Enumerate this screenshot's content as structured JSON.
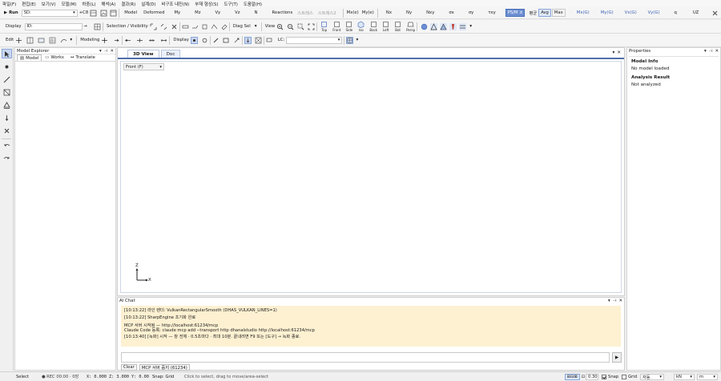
{
  "menu": [
    "파일(F)",
    "편집(E)",
    "보기(V)",
    "모델(M)",
    "하중(L)",
    "해석(A)",
    "결과(R)",
    "설계(D)",
    "비구조 내진(N)",
    "부재 형상(S)",
    "도구(T)",
    "도움말(H)"
  ],
  "toolbar1": {
    "run_label": "Run",
    "run_field": "SD:",
    "buttons": [
      "Model",
      "Deformed",
      "My",
      "Mz",
      "Vy",
      "Vz",
      "N",
      "Reactions"
    ],
    "grey_buttons": [
      "스트레스",
      "스트레스2"
    ],
    "misc": [
      "Mx(e)",
      "My(e)"
    ],
    "force_labels": [
      "Nx",
      "Ny",
      "Nxy",
      "σx",
      "σy",
      "τxy"
    ],
    "mode_button": "PS/M ±",
    "average_label": "평균",
    "avg_button": "Avg",
    "max_button": "Max",
    "result_labels": [
      "Mx(G)",
      "My(G)",
      "Vx(G)",
      "Vy(G)"
    ],
    "q_label": "q",
    "uz_label": "UZ"
  },
  "toolbar2": {
    "display_label": "Display",
    "id_field": "ID:",
    "selection_label": "Selection / Visibility",
    "diag_label": "Diag Sel",
    "view_label": "View",
    "view_buttons": [
      "Top",
      "Front",
      "Side",
      "Iso",
      "Back",
      "Left",
      "Bot",
      "Persp"
    ]
  },
  "toolbar3": {
    "edit_label": "Edit",
    "modeling_label": "Modeling",
    "display_label": "Display",
    "lc_label": "LC:"
  },
  "explorer": {
    "title": "Model Explorer",
    "tabs": [
      "Model",
      "Works",
      "Translate"
    ]
  },
  "view": {
    "tabs": [
      "3D View",
      "Doc"
    ],
    "dropdown": "Front (F)",
    "axis_z": "Z",
    "axis_x": "X"
  },
  "chat": {
    "title": "AI Chat",
    "lines": [
      "[10:13:22] 라인 렌더: VulkanRectangularSmooth (DHAS_VULKAN_LINES=1)",
      "[10:13:22] SharpEngine 초기화 완료",
      "MCP 서버 시작됨 — http://localhost:61234/mcp",
      "Claude Code 등록: claude mcp add --transport http dhanalstudio http://localhost:61234/mcp",
      "[10:13:40] [녹화] 시작 — 창 전체 · 0.5초마다 · 최대 10분. 끝내려면 F9 또는 [도구] → 녹화 종료."
    ],
    "send_icon": "▶",
    "clear_button": "Clear",
    "mcp_button": "MCP 서버 중지 (61234)"
  },
  "properties": {
    "title": "Properties",
    "model_info_heading": "Model Info",
    "model_info_value": "No model loaded",
    "analysis_heading": "Analysis Result",
    "analysis_value": "Not analyzed"
  },
  "status": {
    "mode": "Select",
    "rec": "● REC 00:00 · 0장",
    "x": "X: 0.000",
    "z": "Z: 3.000",
    "y": "Y: 0.00",
    "snap_info": "Snap: Grid",
    "hint": "Click to select, drag to move/area-select",
    "size_field": "0.30",
    "snap_label": "Snap",
    "grid_label": "Grid",
    "auto_select": "자동",
    "unit_force": "kN",
    "unit_length": "m"
  },
  "colors": {
    "accent": "#4f6fa8",
    "chat_bg": "#fdf1d2"
  }
}
